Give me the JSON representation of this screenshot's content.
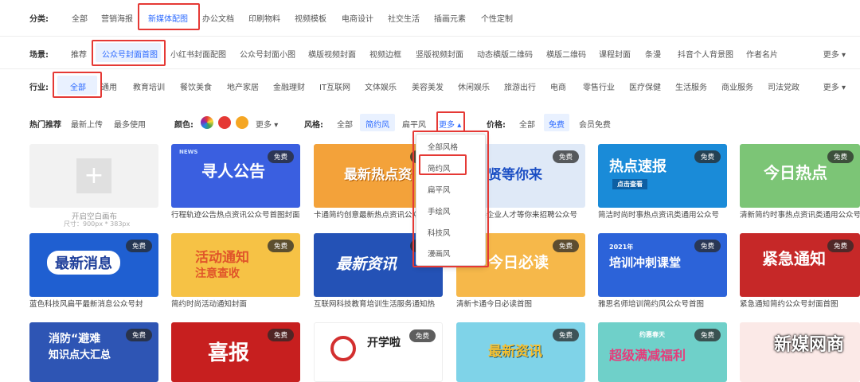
{
  "category": {
    "label": "分类:",
    "items": [
      "全部",
      "营销海报",
      "新媒体配图",
      "办公文档",
      "印刷物料",
      "视频模板",
      "电商设计",
      "社交生活",
      "插画元素",
      "个性定制"
    ]
  },
  "scene": {
    "label": "场景:",
    "items": [
      "推荐",
      "公众号封面首图",
      "小红书封面配图",
      "公众号封面小图",
      "横版视频封面",
      "视频边框",
      "竖版视频封面",
      "动态横版二维码",
      "横版二维码",
      "课程封面",
      "条漫",
      "抖音个人背景图",
      "作者名片"
    ],
    "more": "更多"
  },
  "industry": {
    "label": "行业:",
    "items": [
      "全部",
      "通用",
      "教育培训",
      "餐饮美食",
      "地产家居",
      "金融理财",
      "IT互联网",
      "文体娱乐",
      "美容美发",
      "休闲娱乐",
      "旅游出行",
      "电商",
      "零售行业",
      "医疗保健",
      "生活服务",
      "商业服务",
      "司法党政"
    ],
    "more": "更多"
  },
  "filters": {
    "hot": "热门推荐",
    "latest": "最新上传",
    "most": "最多使用",
    "color_label": "颜色:",
    "color_more": "更多",
    "colors": [
      "#e53935",
      "#f5a623"
    ],
    "style_label": "风格:",
    "style_all": "全部",
    "style_simple": "简约风",
    "style_flat": "扁平风",
    "style_more": "更多",
    "price_label": "价格:",
    "price_all": "全部",
    "price_free": "免费",
    "price_vip": "会员免费"
  },
  "style_dropdown": [
    "全部风格",
    "简约风",
    "扁平风",
    "手绘风",
    "科技风",
    "漫画风"
  ],
  "blank_card": {
    "title": "开启空白画布",
    "size": "尺寸：900px * 383px"
  },
  "free_badge": "免费",
  "cards_row1": [
    {
      "caption": "行程轨迹公告热点资讯公众号首图封面",
      "text": "寻人公告",
      "sub": "NEWS",
      "bg": "#3a5fe0"
    },
    {
      "caption": "卡通简约创意最新热点资讯公众号",
      "text": "最新热点资",
      "bg": "#f3a23a"
    },
    {
      "caption": "扁平风格企业人才等你来招聘公众号",
      "text": "贤等你来",
      "bg": "#dfe9f7"
    },
    {
      "caption": "简洁时尚时事热点资讯类通用公众号",
      "text": "热点速报",
      "sub": "点击查看",
      "bg": "#1a8bd8"
    },
    {
      "caption": "清新简约时事热点资讯类通用公众号",
      "text": "今日热点",
      "bg": "#7cc576"
    }
  ],
  "cards_row2": [
    {
      "caption": "蓝色科技风扁平最新消息公众号封",
      "text": "最新消息",
      "bg": "#1f5fd1"
    },
    {
      "caption": "简约时尚活动通知封面",
      "text": "活动通知",
      "sub": "注意查收",
      "bg": "#f6c245"
    },
    {
      "caption": "互联网科技教育培训生活服务通知热",
      "text": "最新资讯",
      "bg": "#2452b6"
    },
    {
      "caption": "清新卡通今日必读首图",
      "text": "今日必读",
      "bg": "#f6b84a"
    },
    {
      "caption": "雅思名师培训简约风公众号首图",
      "text": "培训冲刺课堂",
      "sub": "2021年",
      "bg": "#2c63d9"
    },
    {
      "caption": "紧急通知简约公众号封面首图",
      "text": "紧急通知",
      "bg": "#c62828"
    }
  ],
  "cards_row3": [
    {
      "text": "消防“避难",
      "sub": "知识点大汇总",
      "bg": "#2e55b4"
    },
    {
      "text": "喜报",
      "bg": "#c71f1f"
    },
    {
      "text": "开学啦",
      "bg": "#ffffff"
    },
    {
      "text": "最新资讯",
      "bg": "#7fd3e8"
    },
    {
      "text": "超级满减福利",
      "sub": "约惠春天",
      "bg": "#6fd0c9"
    },
    {
      "text": "",
      "bg": "#fbe9e7"
    }
  ],
  "watermark": "新媒网商"
}
